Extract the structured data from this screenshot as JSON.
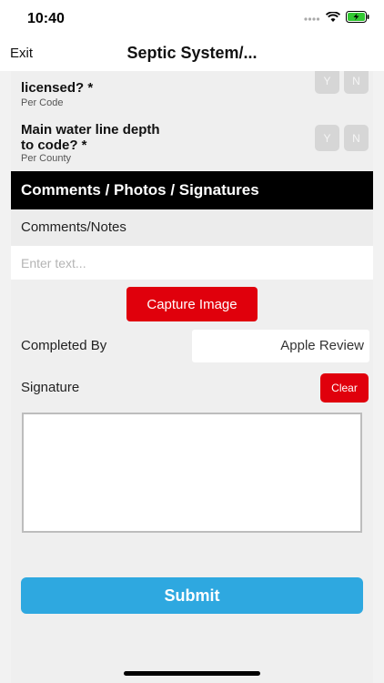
{
  "status": {
    "time": "10:40"
  },
  "nav": {
    "exit_label": "Exit",
    "title": "Septic System/..."
  },
  "questions": [
    {
      "label_line1": "licensed? *",
      "sub": "Per Code",
      "yes": "Y",
      "no": "N"
    },
    {
      "label_line1": "Main water line depth",
      "label_line2": "to code? *",
      "sub": "Per County",
      "yes": "Y",
      "no": "N"
    }
  ],
  "section": {
    "header": "Comments / Photos / Signatures"
  },
  "comments": {
    "label": "Comments/Notes",
    "placeholder": "Enter text..."
  },
  "capture": {
    "label": "Capture Image"
  },
  "completed_by": {
    "label": "Completed By",
    "value": "Apple Review"
  },
  "signature": {
    "label": "Signature",
    "clear_label": "Clear"
  },
  "submit": {
    "label": "Submit"
  },
  "colors": {
    "accent_red": "#e0000c",
    "submit_blue": "#2ea8e0",
    "header_black": "#000000"
  }
}
